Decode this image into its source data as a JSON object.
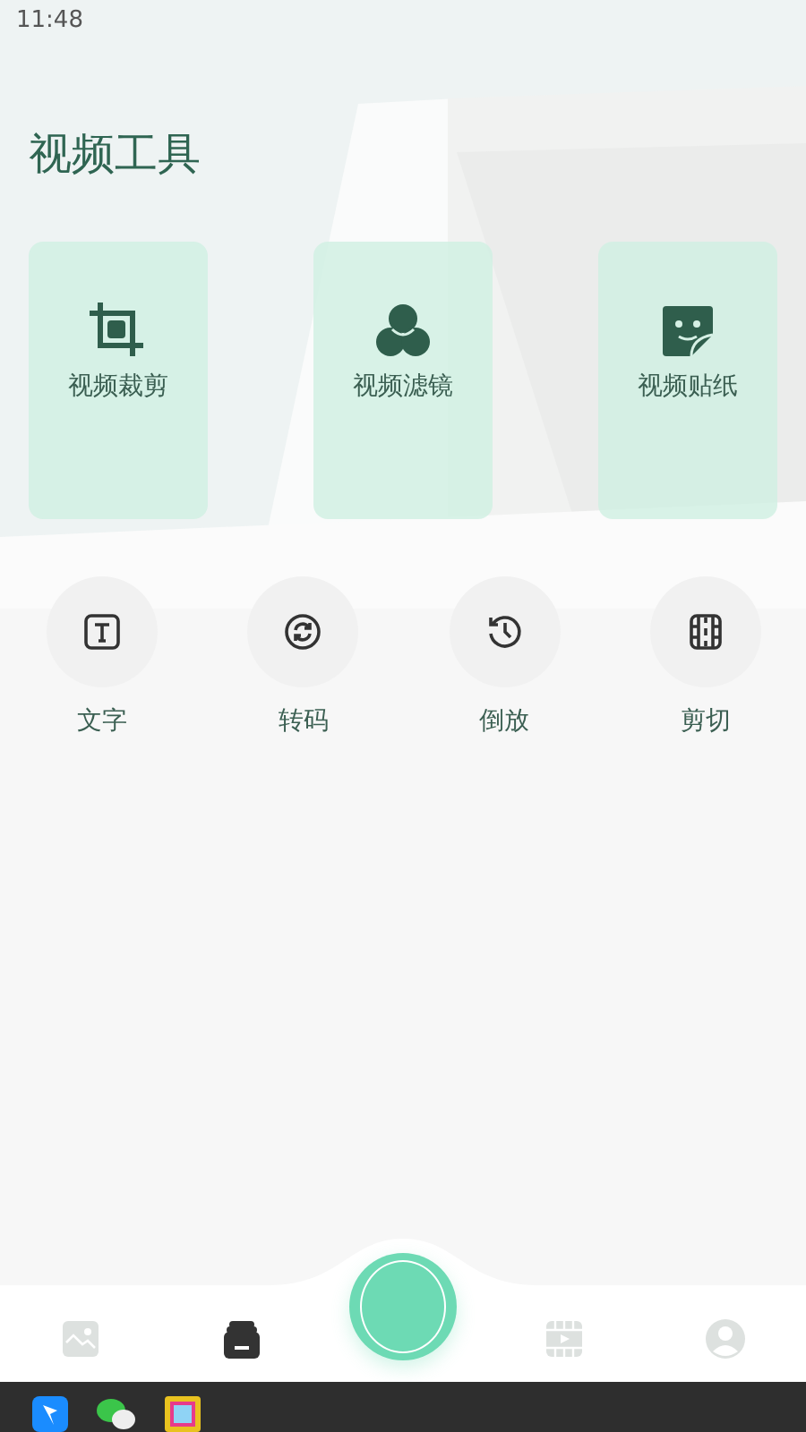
{
  "status_bar": {
    "time": "11:48"
  },
  "title": "视频工具",
  "cards": [
    {
      "kind": "crop",
      "label": "视频裁剪"
    },
    {
      "kind": "filter",
      "label": "视频滤镜"
    },
    {
      "kind": "sticker",
      "label": "视频贴纸"
    }
  ],
  "tools": [
    {
      "kind": "text",
      "label": "文字"
    },
    {
      "kind": "convert",
      "label": "转码"
    },
    {
      "kind": "reverse",
      "label": "倒放"
    },
    {
      "kind": "cut",
      "label": "剪切"
    }
  ],
  "nav": [
    {
      "kind": "gallery",
      "selected": false
    },
    {
      "kind": "toolbox",
      "selected": true
    },
    {
      "kind": "record",
      "selected": false
    },
    {
      "kind": "video",
      "selected": false
    },
    {
      "kind": "profile",
      "selected": false
    }
  ],
  "taskbar": [
    {
      "kind": "blue"
    },
    {
      "kind": "chat"
    },
    {
      "kind": "colorful"
    }
  ]
}
